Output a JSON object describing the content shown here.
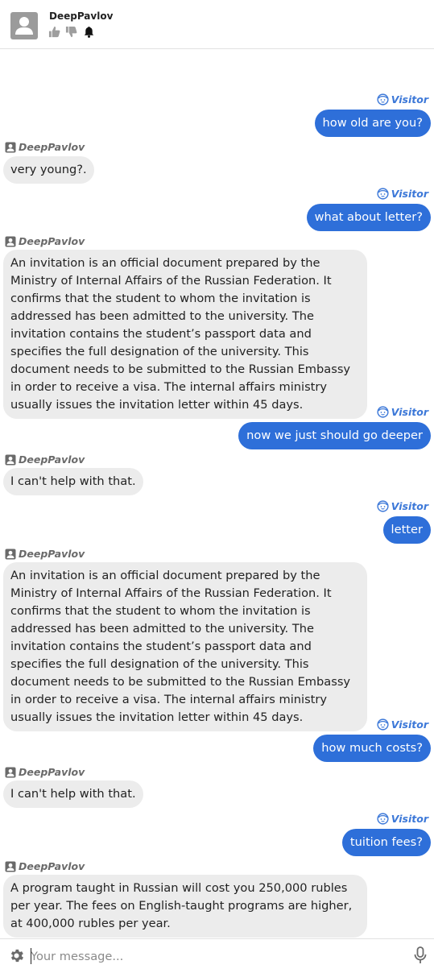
{
  "header": {
    "bot_name": "DeepPavlov",
    "icons": [
      "thumbs-up-icon",
      "thumbs-down-icon",
      "bell-icon"
    ]
  },
  "colors": {
    "user_bubble": "#2e6fd9",
    "bot_bubble": "#ececec",
    "visitor_label": "#3c78d8",
    "bot_label": "#6a6a6a"
  },
  "messages": [
    {
      "sender": "Visitor",
      "text": "how old are you?"
    },
    {
      "sender": "DeepPavlov",
      "text": "very young?."
    },
    {
      "sender": "Visitor",
      "text": "what about letter?"
    },
    {
      "sender": "DeepPavlov",
      "text": "An invitation is an official document prepared by the Ministry of Internal Affairs of the Russian Federation. It confirms that the student to whom the invitation is addressed has been admitted to the university. The invitation contains the student’s passport data and specifies the full designation of the university. This document needs to be submitted to the Russian Embassy in order to receive a visa. The internal affairs ministry usually issues the invitation letter within 45 days."
    },
    {
      "sender": "Visitor",
      "text": "now we just should go deeper"
    },
    {
      "sender": "DeepPavlov",
      "text": "I can't help with that."
    },
    {
      "sender": "Visitor",
      "text": "letter"
    },
    {
      "sender": "DeepPavlov",
      "text": "An invitation is an official document prepared by the Ministry of Internal Affairs of the Russian Federation. It confirms that the student to whom the invitation is addressed has been admitted to the university. The invitation contains the student’s passport data and specifies the full designation of the university. This document needs to be submitted to the Russian Embassy in order to receive a visa. The internal affairs ministry usually issues the invitation letter within 45 days."
    },
    {
      "sender": "Visitor",
      "text": "how much costs?"
    },
    {
      "sender": "DeepPavlov",
      "text": "I can't help with that."
    },
    {
      "sender": "Visitor",
      "text": "tuition fees?"
    },
    {
      "sender": "DeepPavlov",
      "text": "A program taught in Russian will cost you 250,000 rubles per year. The fees on English-taught programs are higher, at 400,000 rubles per year."
    }
  ],
  "composer": {
    "placeholder": "Your message...",
    "settings_icon": "gear-icon",
    "mic_icon": "microphone-icon"
  }
}
